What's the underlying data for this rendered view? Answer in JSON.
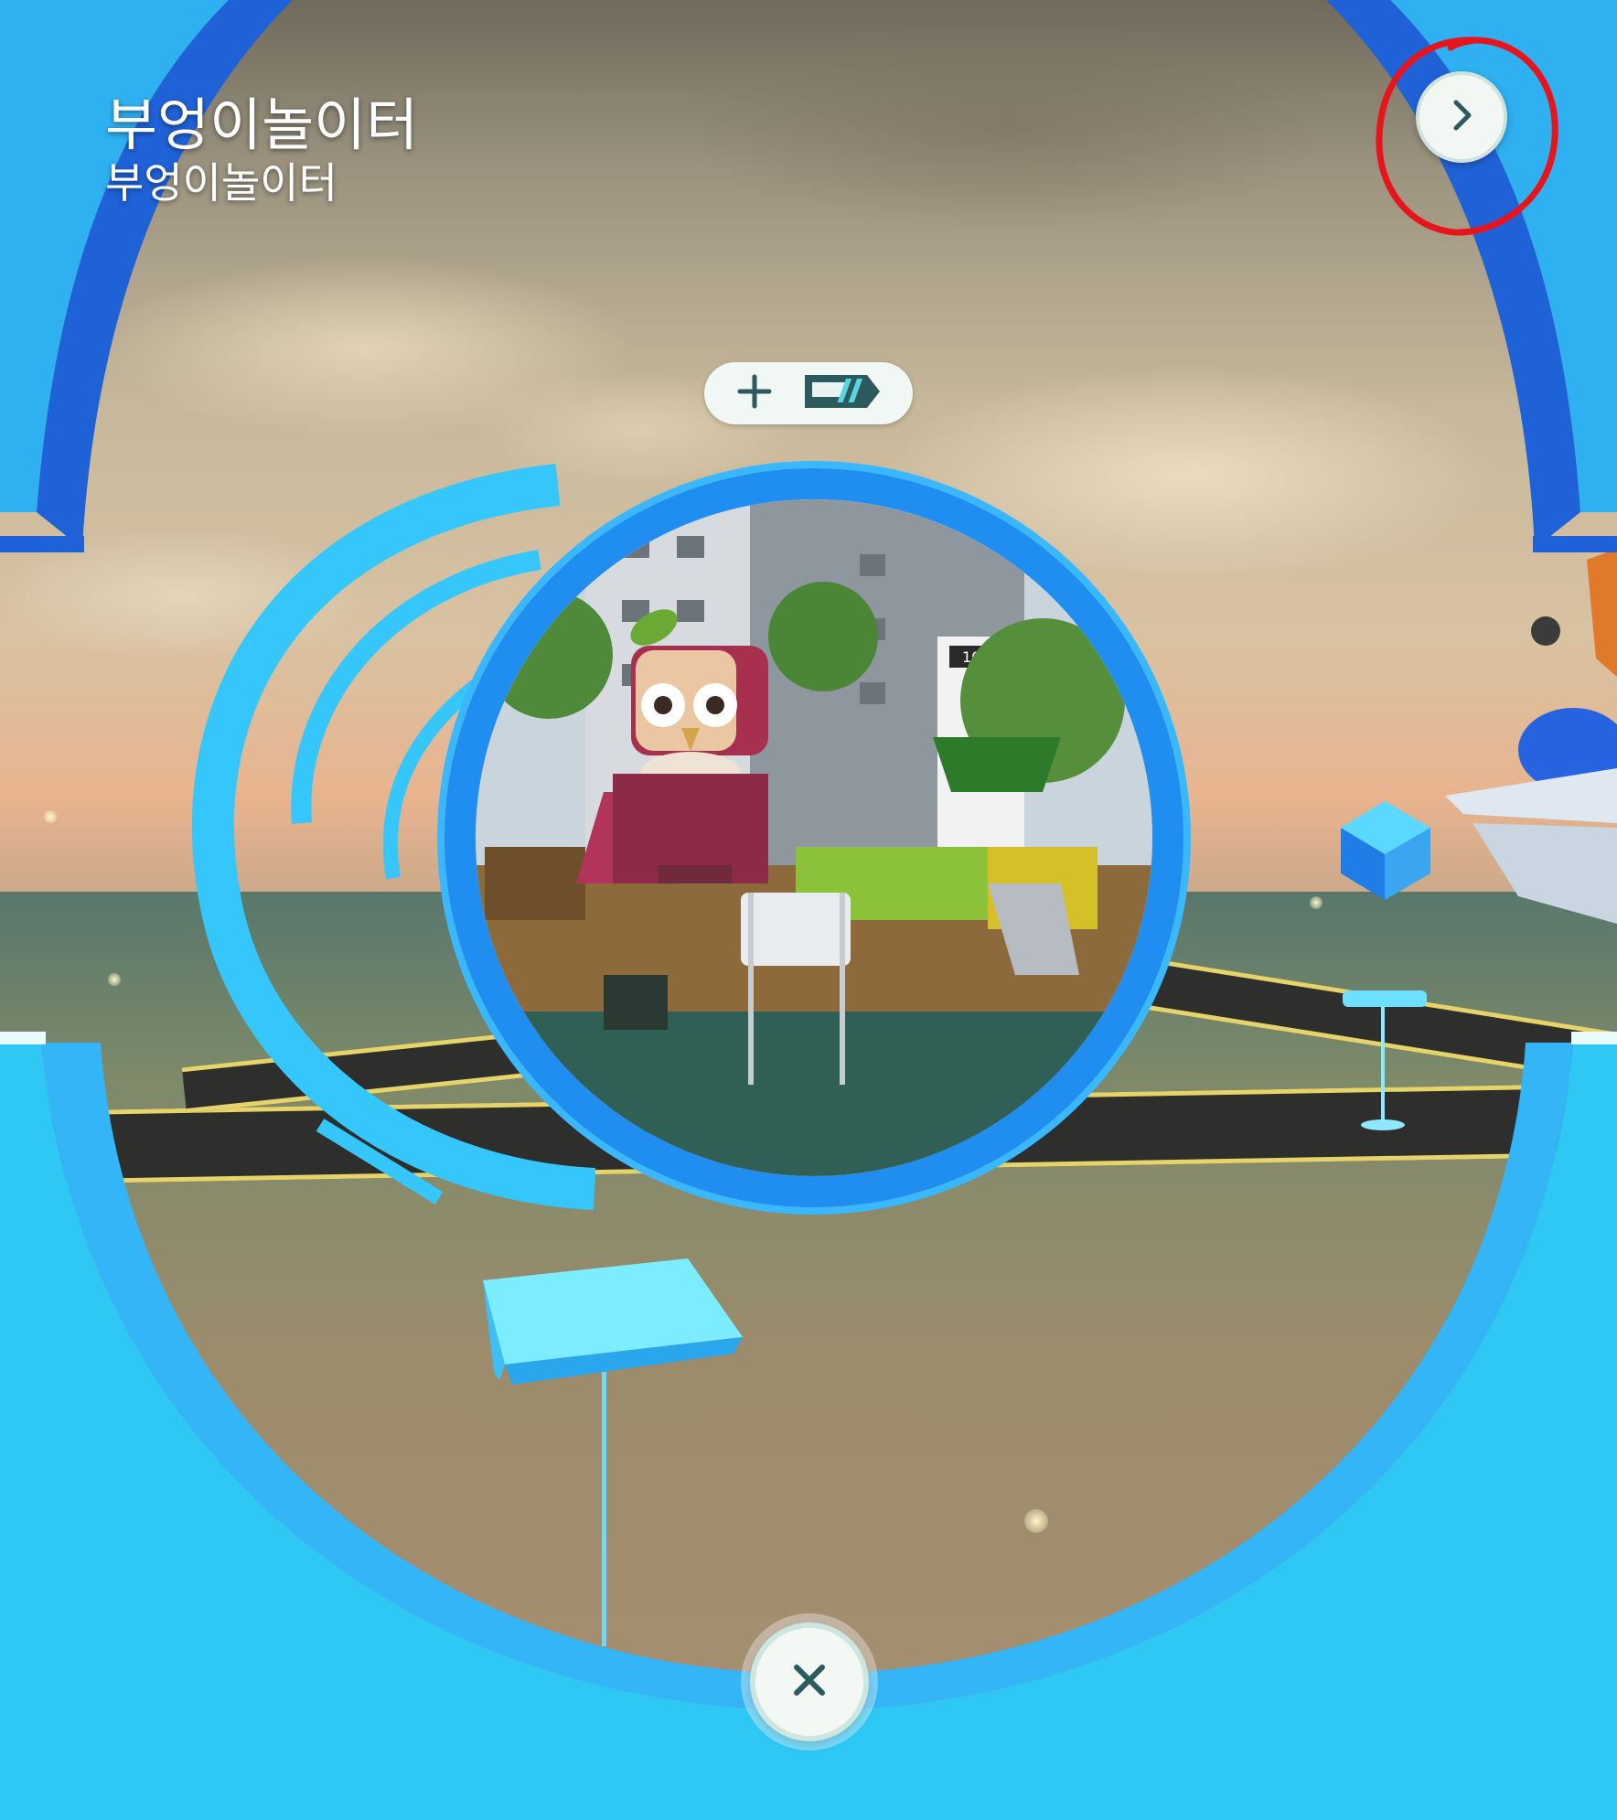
{
  "poi": {
    "title": "부엉이놀이터",
    "subtitle": "부엉이놀이터"
  },
  "thumbnail": {
    "building_sign": "107"
  },
  "icons": {
    "next": "chevron-right-icon",
    "add": "plus-icon",
    "tag": "pass-tag-icon",
    "close": "close-icon"
  },
  "colors": {
    "frame_blue": "#2fc8f5",
    "ring_blue": "#1f8ef0",
    "annotation_red": "#e8141c"
  }
}
